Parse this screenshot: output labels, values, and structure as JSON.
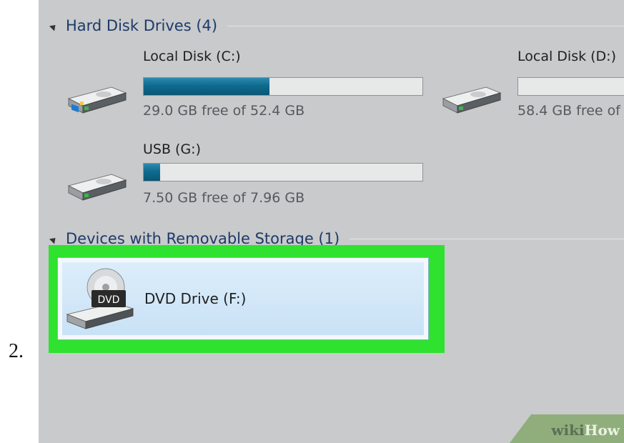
{
  "step": {
    "number": "2."
  },
  "groups": {
    "hard_disk": {
      "title": "Hard Disk Drives (4)"
    },
    "removable": {
      "title": "Devices with Removable Storage (1)"
    }
  },
  "drives": [
    {
      "name": "Local Disk (C:)",
      "free_text": "29.0 GB free of 52.4 GB",
      "used_fraction": 0.45,
      "icon": "windows-hard-drive-icon"
    },
    {
      "name": "Local Disk (D:)",
      "free_text": "58.4 GB free of",
      "used_fraction": 0.0,
      "icon": "hard-drive-icon"
    },
    {
      "name": "USB (G:)",
      "free_text": "7.50 GB free of 7.96 GB",
      "used_fraction": 0.06,
      "icon": "hard-drive-icon"
    }
  ],
  "dvd": {
    "name": "DVD Drive (F:)",
    "icon_label": "DVD",
    "icon": "dvd-drive-icon"
  },
  "colors": {
    "highlight": "#2fe22f",
    "bar_fill": "#0f6a8e",
    "background": "#c8cacb"
  },
  "watermark": {
    "wiki": "wiki",
    "how": "How"
  }
}
